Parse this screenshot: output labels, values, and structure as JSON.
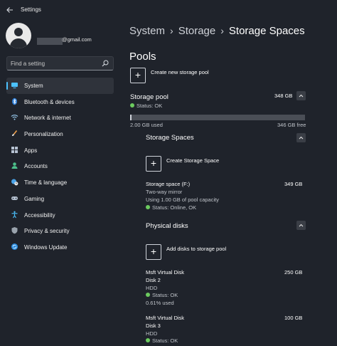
{
  "window": {
    "title": "Settings"
  },
  "user": {
    "email_suffix": "@gmail.com"
  },
  "search": {
    "placeholder": "Find a setting"
  },
  "nav": [
    {
      "label": "System",
      "icon": "monitor-icon",
      "active": true
    },
    {
      "label": "Bluetooth & devices",
      "icon": "bluetooth-icon"
    },
    {
      "label": "Network & internet",
      "icon": "wifi-icon"
    },
    {
      "label": "Personalization",
      "icon": "brush-icon"
    },
    {
      "label": "Apps",
      "icon": "apps-grid-icon"
    },
    {
      "label": "Accounts",
      "icon": "person-icon"
    },
    {
      "label": "Time & language",
      "icon": "globe-clock-icon"
    },
    {
      "label": "Gaming",
      "icon": "gamepad-icon"
    },
    {
      "label": "Accessibility",
      "icon": "accessibility-icon"
    },
    {
      "label": "Privacy & security",
      "icon": "shield-icon"
    },
    {
      "label": "Windows Update",
      "icon": "update-icon"
    }
  ],
  "breadcrumb": {
    "level1": "System",
    "level2": "Storage",
    "level3": "Storage Spaces",
    "separator": "›"
  },
  "page": {
    "heading": "Pools",
    "create_pool_label": "Create new storage pool",
    "pool": {
      "name": "Storage pool",
      "size": "348 GB",
      "status": "Status: OK",
      "used": "2.00 GB used",
      "free": "346 GB free",
      "used_fraction": 0.006
    },
    "storage_spaces": {
      "heading": "Storage Spaces",
      "create_label": "Create Storage Space",
      "space": {
        "name": "Storage space (F:)",
        "size": "349 GB",
        "resiliency": "Two-way mirror",
        "usage": "Using 1.00 GB of pool capacity",
        "status": "Status: Online, OK"
      }
    },
    "physical_disks": {
      "heading": "Physical disks",
      "add_label": "Add disks to storage pool",
      "disks": [
        {
          "name": "Msft Virtual Disk",
          "number": "Disk 2",
          "type": "HDD",
          "status": "Status: OK",
          "used": "0.61% used",
          "size": "250 GB"
        },
        {
          "name": "Msft Virtual Disk",
          "number": "Disk 3",
          "type": "HDD",
          "status": "Status: OK",
          "size": "100 GB"
        }
      ]
    }
  },
  "colors": {
    "accent": "#4cc2ff",
    "status_ok": "#6ccb5f",
    "background": "#1f232b"
  }
}
